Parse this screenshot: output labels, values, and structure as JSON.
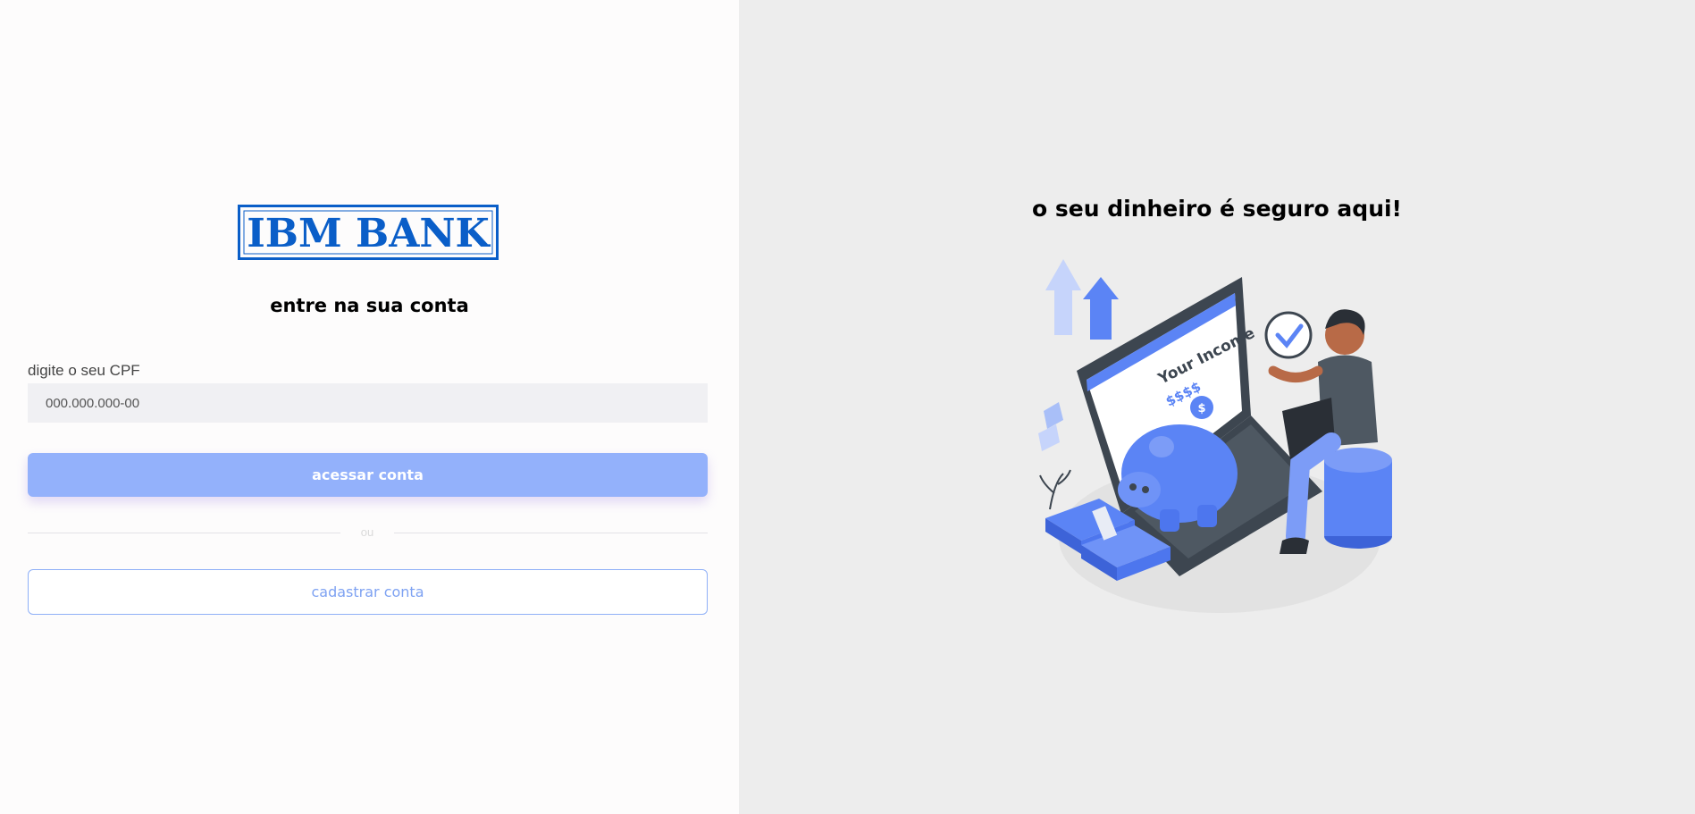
{
  "brand": {
    "logo_text": "IBM BANK",
    "color": "#0a5ec8"
  },
  "login": {
    "title": "entre na sua conta",
    "cpf_label": "digite o seu CPF",
    "cpf_placeholder": "000.000.000-00",
    "cpf_value": "",
    "access_button": "acessar conta",
    "divider_text": "ou",
    "register_button": "cadastrar conta"
  },
  "promo": {
    "title": "o seu dinheiro é seguro aqui!",
    "illustration_text": "Your Income",
    "illustration_amount": "$$$$"
  },
  "colors": {
    "primary_button": "#93b1fb",
    "accent_blue": "#5b84f5",
    "right_panel_bg": "#ededed"
  }
}
